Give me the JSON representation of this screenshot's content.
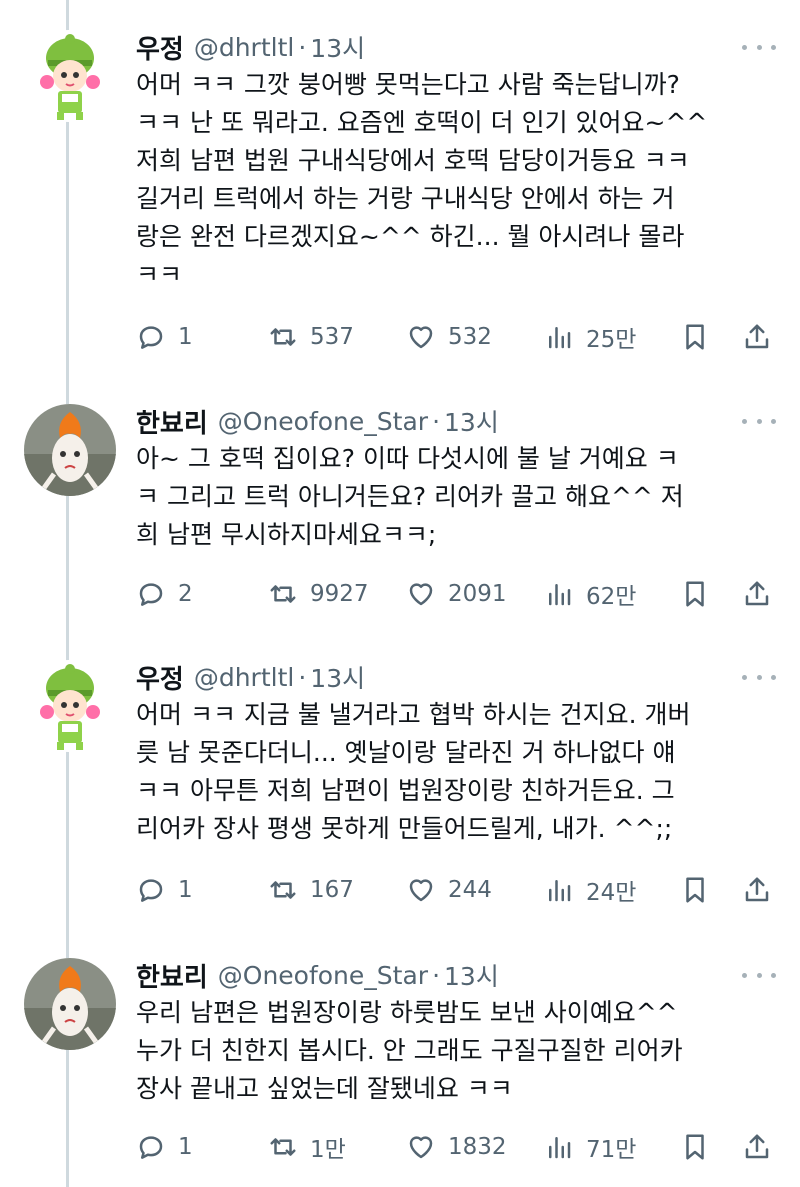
{
  "tweets": [
    {
      "name": "우정",
      "handle": "@dhrtltl",
      "time": "13시",
      "avatar": "green-hat-girl-avatar",
      "text": "어머 ㅋㅋ 그깟 붕어빵 못먹는다고 사람 죽는답니까?\nㅋㅋ 난 또 뭐라고. 요즘엔 호떡이 더 인기 있어요~^^\n저희 남편 법원 구내식당에서 호떡 담당이거등요 ㅋㅋ\n길거리 트럭에서 하는 거랑 구내식당 안에서 하는 거\n랑은 완전 다르겠지요~^^ 하긴... 뭘 아시려나 몰라\nㅋㅋ",
      "replies": "1",
      "retweets": "537",
      "likes": "532",
      "views": "25만"
    },
    {
      "name": "한뵤리",
      "handle": "@Oneofone_Star",
      "time": "13시",
      "avatar": "goldfish-avatar",
      "text": "아~ 그 호떡 집이요? 이따 다섯시에 불 날 거예요 ㅋ\nㅋ 그리고 트럭 아니거든요? 리어카 끌고 해요^^ 저\n희 남편 무시하지마세요ㅋㅋ;",
      "replies": "2",
      "retweets": "9927",
      "likes": "2091",
      "views": "62만"
    },
    {
      "name": "우정",
      "handle": "@dhrtltl",
      "time": "13시",
      "avatar": "green-hat-girl-avatar",
      "text": "어머 ㅋㅋ 지금 불 낼거라고 협박 하시는 건지요. 개버\n릇 남 못준다더니... 옛날이랑 달라진 거 하나없다 얘\nㅋㅋ 아무튼 저희 남편이 법원장이랑 친하거든요. 그\n리어카 장사 평생 못하게 만들어드릴게, 내가. ^^;;",
      "replies": "1",
      "retweets": "167",
      "likes": "244",
      "views": "24만"
    },
    {
      "name": "한뵤리",
      "handle": "@Oneofone_Star",
      "time": "13시",
      "avatar": "goldfish-avatar",
      "text": "우리 남편은 법원장이랑 하룻밤도 보낸 사이예요^^\n누가 더 친한지 봅시다. 안 그래도 구질구질한 리어카\n장사 끝내고 싶었는데 잘됐네요 ㅋㅋ",
      "replies": "1",
      "retweets": "1만",
      "likes": "1832",
      "views": "71만"
    }
  ],
  "separator": "·",
  "colors": {
    "text": "#0f1419",
    "muted": "#536471",
    "thread_line": "#cfd9de"
  }
}
